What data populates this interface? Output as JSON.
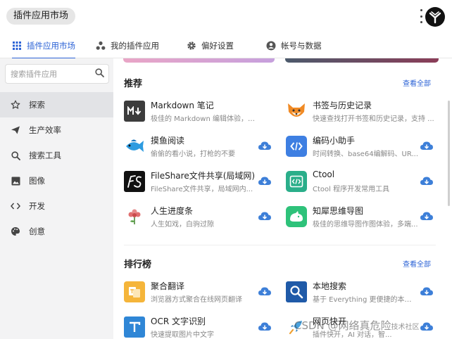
{
  "header": {
    "title": "插件应用市场"
  },
  "tabs": [
    {
      "label": "插件应用市场",
      "icon": "grid-icon"
    },
    {
      "label": "我的插件应用",
      "icon": "molecule-icon"
    },
    {
      "label": "偏好设置",
      "icon": "gear-icon"
    },
    {
      "label": "帐号与数据",
      "icon": "user-icon"
    }
  ],
  "sidebar": {
    "search_placeholder": "搜索插件应用",
    "items": [
      {
        "label": "探索",
        "icon": "star-icon"
      },
      {
        "label": "生产效率",
        "icon": "paper-plane-icon"
      },
      {
        "label": "搜索工具",
        "icon": "search-icon"
      },
      {
        "label": "图像",
        "icon": "image-icon"
      },
      {
        "label": "开发",
        "icon": "code-icon"
      },
      {
        "label": "创意",
        "icon": "palette-icon"
      }
    ]
  },
  "sections": [
    {
      "title": "推荐",
      "see_all": "查看全部",
      "apps": [
        {
          "name": "Markdown 笔记",
          "desc": "极佳的 Markdown 编辑体验，实时...",
          "icon": "markdown-icon",
          "download": false
        },
        {
          "name": "书签与历史记录",
          "desc": "快速查找打开书签和历史记录，支持 ...",
          "icon": "fox-icon",
          "download": false
        },
        {
          "name": "摸鱼阅读",
          "desc": "偷偷的看小说，打枪的不要",
          "icon": "fish-icon",
          "download": true
        },
        {
          "name": "编码小助手",
          "desc": "时间转换、base64编解码、UR...",
          "icon": "code-bracket-icon",
          "download": true
        },
        {
          "name": "FileShare文件共享(局域网)",
          "desc": "FileShare文件共享，局域网内...",
          "icon": "fileshare-icon",
          "download": true
        },
        {
          "name": "Ctool",
          "desc": "Ctool 程序开发常用工具",
          "icon": "ctool-icon",
          "download": true
        },
        {
          "name": "人生进度条",
          "desc": "人生如戏，白驹过隙",
          "icon": "flower-icon",
          "download": true
        },
        {
          "name": "知犀思维导图",
          "desc": "极佳的思维导图作图体验，多端...",
          "icon": "rhino-icon",
          "download": true
        }
      ]
    },
    {
      "title": "排行榜",
      "see_all": "查看全部",
      "apps": [
        {
          "name": "聚合翻译",
          "desc": "浏览器方式聚合在线网页翻译",
          "icon": "translate-icon",
          "download": true
        },
        {
          "name": "本地搜索",
          "desc": "基于 Everything 更便捷的本地...",
          "icon": "local-search-icon",
          "download": true
        },
        {
          "name": "OCR 文字识别",
          "desc": "快速提取图片中文字",
          "icon": "ocr-icon",
          "download": true
        },
        {
          "name": "网页快开",
          "desc": "插件快开，AI 对话，智...",
          "icon": "rocket-icon",
          "download": true
        }
      ]
    }
  ],
  "watermark": {
    "main": "CSDN @网络真危险",
    "tail": "技术社区"
  },
  "colors": {
    "accent": "#2c63d6",
    "cloud": "#3d7fd8",
    "sidebar_bg": "#f3f3f4"
  }
}
